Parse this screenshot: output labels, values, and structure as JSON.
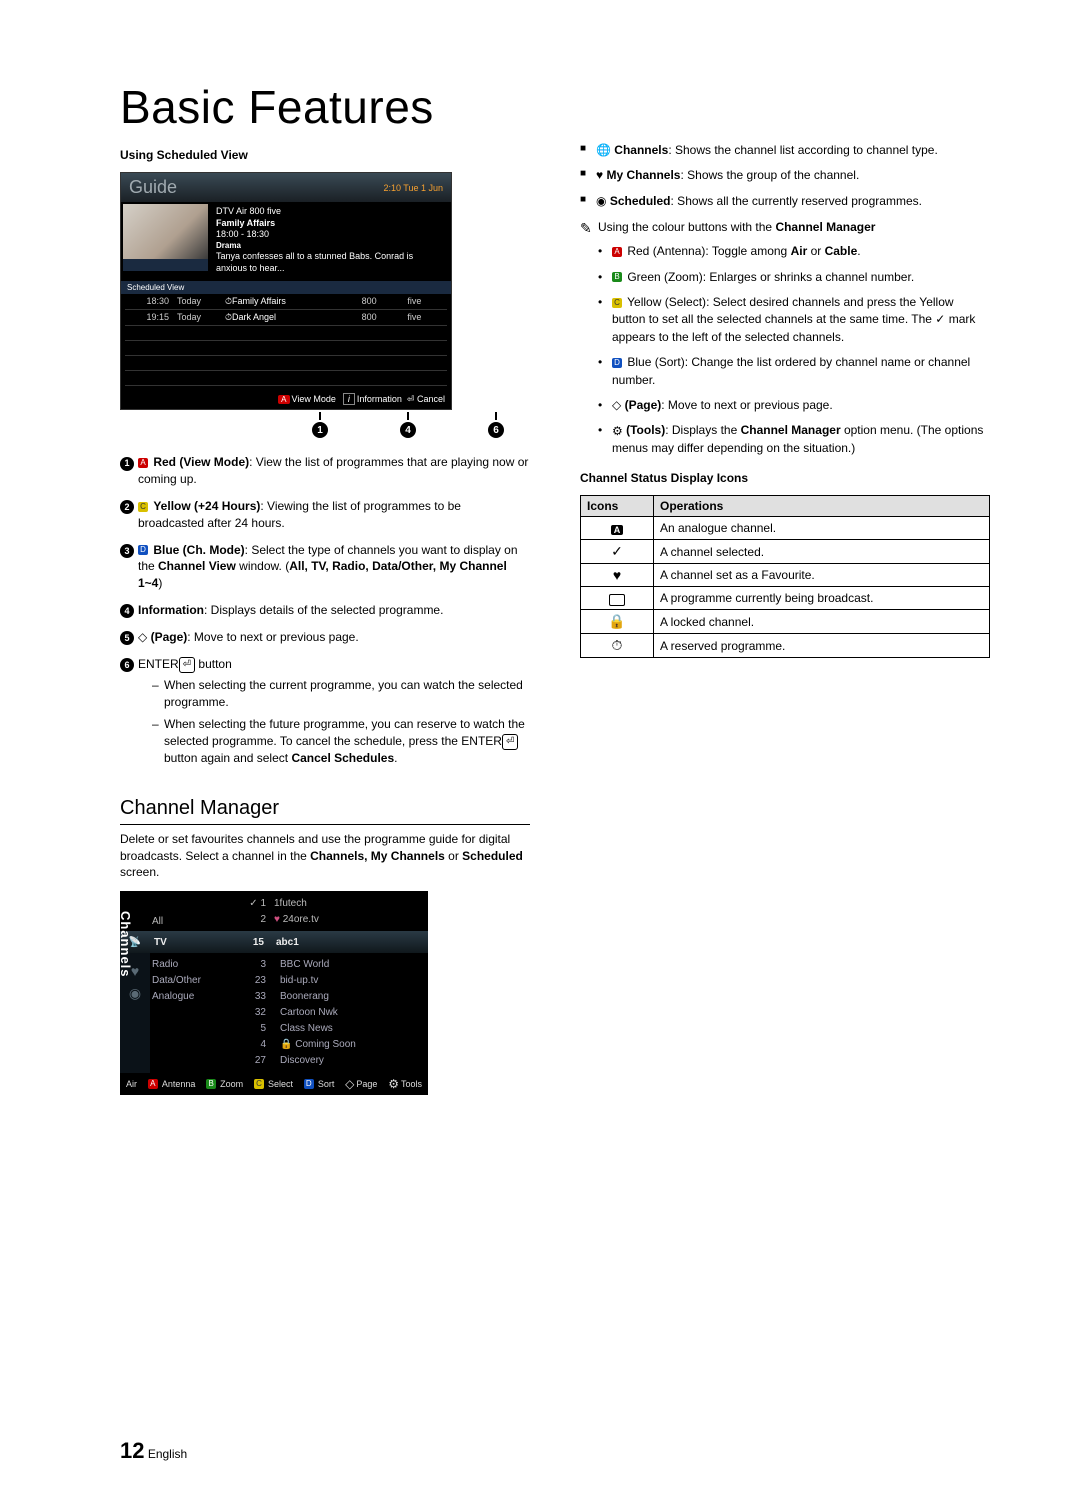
{
  "title": "Basic Features",
  "left": {
    "scheduled_heading": "Using Scheduled View",
    "guide": {
      "title": "Guide",
      "clock": "2:10 Tue 1 Jun",
      "info_source": "DTV Air 800 five",
      "info_prog": "Family Affairs",
      "info_time": "18:00 - 18:30",
      "info_genre": "Drama",
      "info_desc": "Tanya confesses all to a stunned Babs. Conrad is anxious to hear...",
      "scheduled_view_label": "Scheduled View",
      "rows": [
        {
          "time": "18:30",
          "day": "Today",
          "prog": "Family Affairs",
          "num": "800",
          "chan": "five"
        },
        {
          "time": "19:15",
          "day": "Today",
          "prog": "Dark Angel",
          "num": "800",
          "chan": "five"
        }
      ],
      "footer": {
        "view_mode": "View Mode",
        "information": "Information",
        "cancel": "Cancel"
      },
      "callouts": [
        "1",
        "4",
        "6"
      ]
    },
    "numbered": [
      {
        "n": "1",
        "pre": "A",
        "preClass": "tag-red",
        "label": "Red (View Mode)",
        "text": ": View the list of programmes that are playing now or coming up."
      },
      {
        "n": "2",
        "pre": "C",
        "preClass": "tag-yellow",
        "label": "Yellow (+24 Hours)",
        "text": ": Viewing the list of programmes to be broadcasted after 24 hours."
      },
      {
        "n": "3",
        "pre": "D",
        "preClass": "tag-blue",
        "label": "Blue (Ch. Mode)",
        "text": ": Select the type of channels you want to display on the ",
        "label2": "Channel View",
        "text2": " window. (",
        "label3": "All, TV, Radio, Data/Other, My Channel 1~4",
        "text3": ")"
      },
      {
        "n": "4",
        "label": "Information",
        "text": ": Displays details of the selected programme."
      },
      {
        "n": "5",
        "icon": "updown",
        "label": "(Page)",
        "text": ": Move to next or previous page."
      },
      {
        "n": "6",
        "label": "ENTER",
        "icon2": "enter",
        "text": " button",
        "subs": [
          "When selecting the current programme, you can watch the selected programme.",
          "When selecting the future programme, you can reserve to watch the selected programme. To cancel the schedule, press the ENTER button again and select Cancel Schedules."
        ]
      }
    ],
    "cm_heading": "Channel Manager",
    "cm_intro_a": "Delete or set favourites channels and use the programme guide for digital broadcasts. Select a channel in the ",
    "cm_intro_b": "Channels, My Channels",
    "cm_intro_c": " or ",
    "cm_intro_d": "Scheduled",
    "cm_intro_e": " screen.",
    "cm_box": {
      "side": "Channels",
      "top_nums": [
        "1",
        "2"
      ],
      "top_names": [
        "1futech",
        "24ore.tv"
      ],
      "top_cat": "All",
      "hdr_cat": "TV",
      "hdr_num": "15",
      "hdr_name": "abc1",
      "body_cats": [
        "Radio",
        "Data/Other",
        "Analogue"
      ],
      "body_nums": [
        "3",
        "23",
        "33",
        "32",
        "5",
        "4",
        "27"
      ],
      "body_names": [
        "BBC World",
        "bid-up.tv",
        "Boonerang",
        "Cartoon Nwk",
        "Class News",
        "Coming Soon",
        "Discovery"
      ],
      "footer": {
        "air": "Air",
        "antenna": "Antenna",
        "zoom": "Zoom",
        "select": "Select",
        "sort": "Sort",
        "page": "Page",
        "tools": "Tools"
      }
    }
  },
  "right": {
    "blk": [
      {
        "label": "Channels",
        "text": ": Shows the channel list according to channel type."
      },
      {
        "label": "My Channels",
        "text": ": Shows the group of the channel."
      },
      {
        "label": "Scheduled",
        "text": ": Shows all the currently reserved programmes."
      }
    ],
    "note_text_a": "Using the colour buttons with the ",
    "note_text_b": "Channel Manager",
    "dots": [
      {
        "pre": "A",
        "preClass": "tag-red",
        "label": "Red (Antenna)",
        "text": ": Toggle among ",
        "label2": "Air",
        "mid": " or ",
        "label3": "Cable",
        "tail": "."
      },
      {
        "pre": "B",
        "preClass": "tag-green",
        "label": "Green (Zoom)",
        "text": ": Enlarges or shrinks a channel number."
      },
      {
        "pre": "C",
        "preClass": "tag-yellow",
        "label": "Yellow (Select)",
        "text": ": Select desired channels and press the Yellow button to set all the selected channels at the same time. The ✓ mark appears to the left of the selected channels."
      },
      {
        "pre": "D",
        "preClass": "tag-blue",
        "label": "Blue (Sort)",
        "text": ": Change the list ordered by channel name or channel number."
      },
      {
        "icon": "updown",
        "label": "(Page)",
        "text": ": Move to next or previous page."
      },
      {
        "icon": "tools",
        "label": "(Tools)",
        "text": ": Displays the ",
        "label2": "Channel Manager",
        "text2": " option menu. (The options menus may differ depending on the situation.)"
      }
    ],
    "icons_heading": "Channel Status Display Icons",
    "icons_table": {
      "h1": "Icons",
      "h2": "Operations",
      "rows": [
        {
          "icon": "A",
          "type": "abox",
          "op": "An analogue channel."
        },
        {
          "icon": "✓",
          "op": "A channel selected."
        },
        {
          "icon": "♥",
          "op": "A channel set as a Favourite."
        },
        {
          "icon": "tv",
          "type": "tv",
          "op": "A programme currently being broadcast."
        },
        {
          "icon": "🔒",
          "op": "A locked channel."
        },
        {
          "icon": "⏱",
          "op": "A reserved programme."
        }
      ]
    }
  },
  "footer": {
    "num": "12",
    "lang": "English"
  }
}
